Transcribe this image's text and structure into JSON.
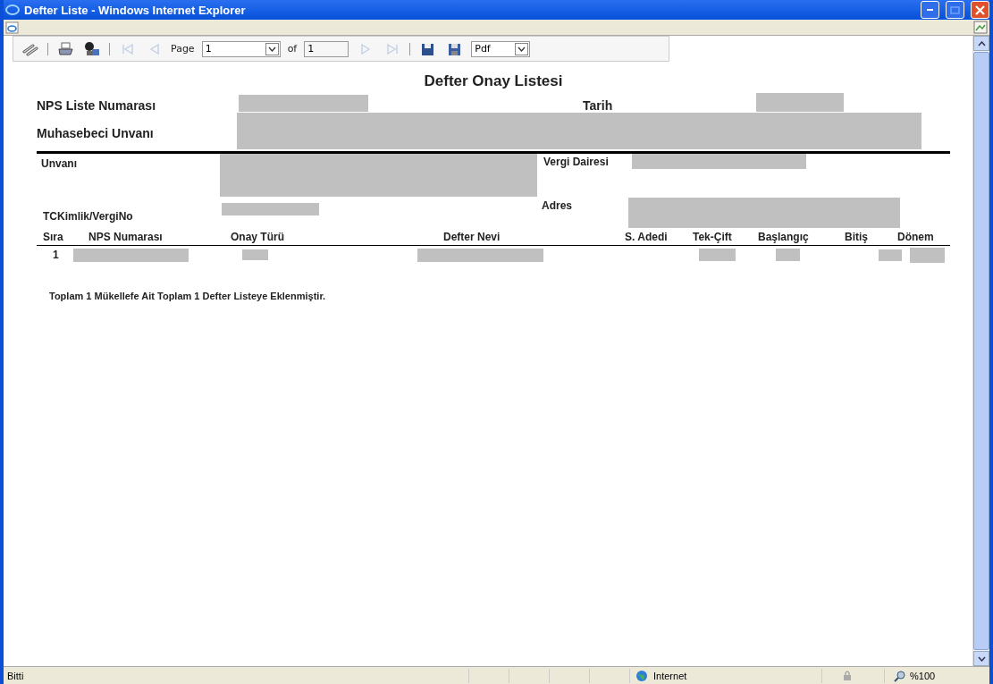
{
  "window": {
    "title": "Defter Liste - Windows Internet Explorer"
  },
  "toolbar": {
    "items": [
      {
        "kind": "button",
        "disabled": false
      },
      {
        "kind": "separator"
      },
      {
        "kind": "button",
        "disabled": false
      },
      {
        "kind": "button",
        "disabled": false
      },
      {
        "kind": "separator"
      },
      {
        "kind": "button",
        "disabled": true
      },
      {
        "kind": "button",
        "disabled": true
      },
      {
        "kind": "label",
        "text": "Page"
      },
      {
        "kind": "select",
        "value": "1"
      },
      {
        "kind": "label",
        "text": "of"
      },
      {
        "kind": "field",
        "value": "1"
      },
      {
        "kind": "button",
        "disabled": true
      },
      {
        "kind": "button",
        "disabled": true
      },
      {
        "kind": "separator"
      },
      {
        "kind": "button",
        "disabled": false
      },
      {
        "kind": "button",
        "disabled": false
      },
      {
        "kind": "select",
        "value": "Pdf"
      }
    ]
  },
  "report": {
    "title": "Defter Onay Listesi",
    "header_fields": {
      "nps_liste_numarasi": "NPS Liste Numarası",
      "tarih": "Tarih",
      "muhasebeci_unvani": "Muhasebeci Unvanı"
    },
    "taxpayer_fields": {
      "unvani": "Unvanı",
      "vergi_dairesi": "Vergi Dairesi",
      "tckimlik": "TCKimlik/VergiNo",
      "adres": "Adres"
    },
    "table": {
      "columns": [
        "Sıra",
        "NPS Numarası",
        "Onay Türü",
        "Defter Nevi",
        "S. Adedi",
        "Tek-Çift",
        "Başlangıç",
        "Bitiş",
        "Dönem"
      ],
      "rows": [
        {
          "sira": "1"
        }
      ]
    },
    "summary": "Toplam 1 Mükellefe Ait Toplam 1 Defter Listeye Eklenmiştir."
  },
  "status_bar": {
    "text": "Bitti",
    "zone": "Internet",
    "zoom": "%100"
  }
}
